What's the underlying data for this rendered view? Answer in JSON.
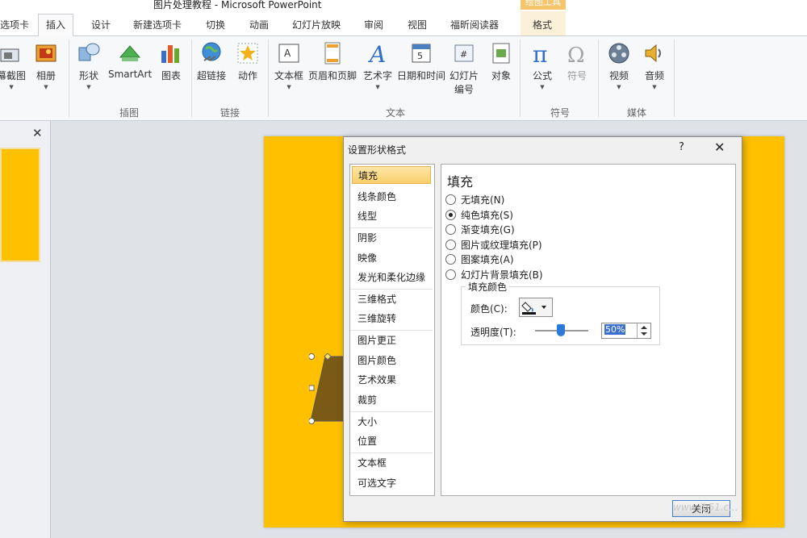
{
  "window": {
    "title": "图片处理教程 - Microsoft PowerPoint",
    "context_tool": "绘图工具"
  },
  "tabs": [
    "选项卡",
    "插入",
    "设计",
    "新建选项卡",
    "切换",
    "动画",
    "幻灯片放映",
    "审阅",
    "视图",
    "福昕阅读器",
    "格式"
  ],
  "active_tab": "插入",
  "ribbon": {
    "images_group": {
      "label": "插图",
      "screenshot": "幕截图",
      "album": "相册",
      "shapes": "形状",
      "smartart": "SmartArt",
      "chart": "图表"
    },
    "links_group": {
      "label": "链接",
      "hyperlink": "超链接",
      "action": "动作"
    },
    "text_group": {
      "label": "文本",
      "textbox": "文本框",
      "header_footer": "页眉和页脚",
      "wordart": "艺术字",
      "datetime": "日期和时间",
      "slide_number_1": "幻灯片",
      "slide_number_2": "编号",
      "object": "对象"
    },
    "symbols_group": {
      "label": "符号",
      "equation": "公式",
      "symbol": "符号"
    },
    "media_group": {
      "label": "媒体",
      "video": "视频",
      "audio": "音频"
    }
  },
  "panel": {
    "close": "✕"
  },
  "dialog": {
    "title": "设置形状格式",
    "help": "?",
    "close": "✕",
    "nav": [
      "填充",
      "线条颜色",
      "线型",
      "阴影",
      "映像",
      "发光和柔化边缘",
      "三维格式",
      "三维旋转",
      "图片更正",
      "图片颜色",
      "艺术效果",
      "裁剪",
      "大小",
      "位置",
      "文本框",
      "可选文字"
    ],
    "selected_nav": "填充",
    "section_title": "填充",
    "fill_options": [
      "无填充(N)",
      "纯色填充(S)",
      "渐变填充(G)",
      "图片或纹理填充(P)",
      "图案填充(A)",
      "幻灯片背景填充(B)"
    ],
    "selected_fill": "纯色填充(S)",
    "fill_color_group": "填充颜色",
    "color_label": "颜色(C):",
    "transparency_label": "透明度(T):",
    "transparency_value": "50%",
    "close_button": "关闭"
  },
  "watermark": "www.jb51.c...",
  "colors": {
    "slide": "#ffc000",
    "shape": "#7a5a14",
    "selection": "#f9cf6b"
  }
}
